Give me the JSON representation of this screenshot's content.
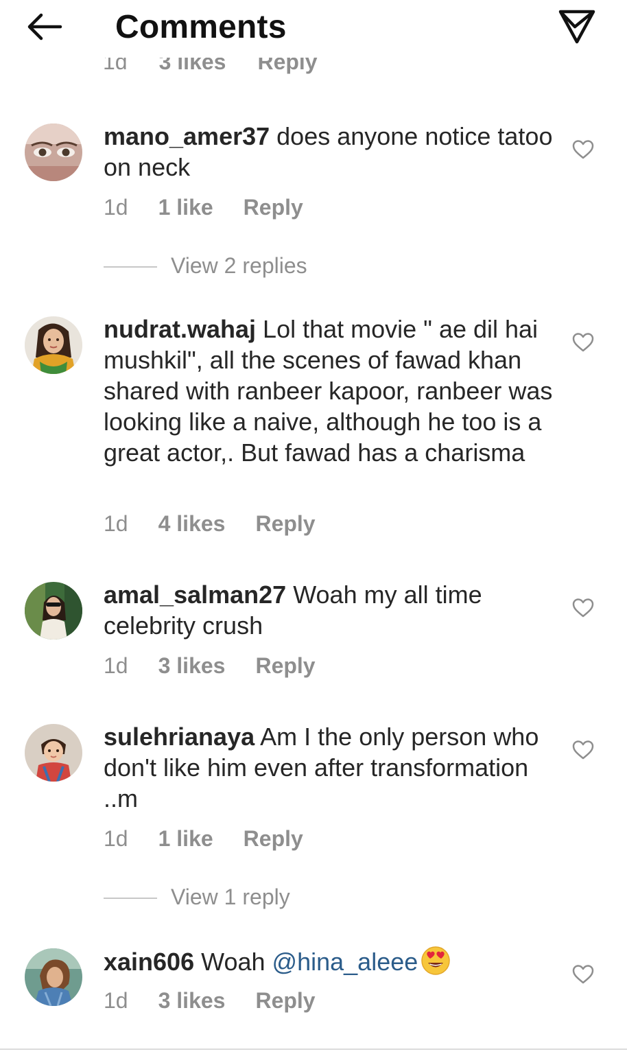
{
  "header": {
    "title": "Comments",
    "back_icon": "back-arrow-icon",
    "share_icon": "direct-share-icon"
  },
  "partial_row": {
    "age": "1d",
    "likes": "3 likes",
    "reply": "Reply"
  },
  "comments": [
    {
      "username": "mano_amer37",
      "text": "does anyone notice tatoo on neck",
      "age": "1d",
      "likes": "1 like",
      "reply": "Reply",
      "view_replies": "View 2 replies"
    },
    {
      "username": "nudrat.wahaj",
      "text": "Lol that movie \" ae dil hai mushkil\", all the scenes of fawad khan shared with ranbeer kapoor, ranbeer was looking like a naive, although he too is a great actor,. But fawad has a charisma",
      "age": "1d",
      "likes": "4 likes",
      "reply": "Reply"
    },
    {
      "username": "amal_salman27",
      "text": "Woah my all time celebrity crush",
      "age": "1d",
      "likes": "3 likes",
      "reply": "Reply"
    },
    {
      "username": "sulehrianaya",
      "text": "Am I the only person who don't like him even after transformation ..m",
      "age": "1d",
      "likes": "1 like",
      "reply": "Reply",
      "view_replies": "View 1 reply"
    },
    {
      "username": "xain606",
      "text_prefix": "Woah",
      "mention": "@hina_aleee",
      "emoji": "heart-eyes-emoji",
      "age": "1d",
      "likes": "3 likes",
      "reply": "Reply"
    }
  ],
  "colors": {
    "text": "#262626",
    "secondary": "#8e8e8e",
    "mention": "#2b5c8a",
    "divider": "#c7c7c7"
  }
}
